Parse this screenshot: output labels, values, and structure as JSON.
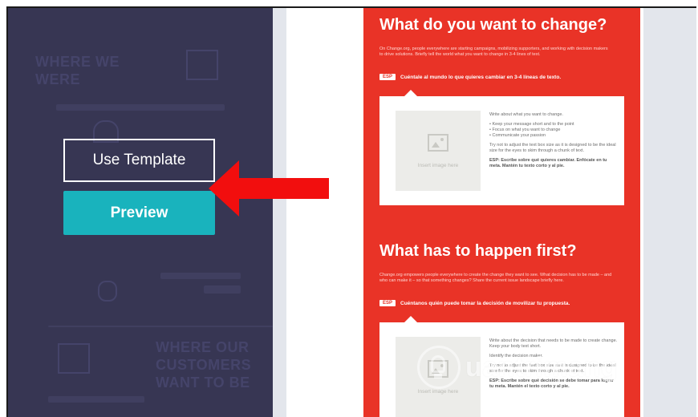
{
  "left_panel": {
    "ghost_heading_1": "WHERE WE WERE",
    "ghost_heading_2": "WHERE OUR CUSTOMERS WANT TO BE",
    "use_template_label": "Use Template",
    "preview_label": "Preview",
    "bg_color": "#373653",
    "preview_color": "#19b3bd"
  },
  "preview": {
    "bg_color": "#e93327",
    "section1": {
      "title": "What do you want to change?",
      "intro": "On Change.org, people everywhere are starting campaigns, mobilizing supporters, and working with decision makers to drive solutions. Briefly tell the world what you want to change in 3-4 lines of text.",
      "esp_tag": "ESP",
      "esp_text": "Cuéntale al mundo lo que quieres cambiar en 3-4 líneas de texto.",
      "image_caption": "Insert image here",
      "card_lead": "Write about what you want to change.",
      "bullets": [
        "Keep your message short and to the point",
        "Focus on what you want to change",
        "Communicate your passion"
      ],
      "card_note": "Try not to adjust the text box size as it is designed to be the ideal size for the eyes to skim through a chunk of text.",
      "card_esp": "ESP: Escribe sobre qué quieres cambiar. Enfócate en tu meta. Mantén tu texto corto y al pie."
    },
    "section2": {
      "title": "What has to happen first?",
      "intro": "Change.org empowers people everywhere to create the change they want to see. What decision has to be made – and who can make it – so that something changes? Share the current issue landscape briefly here.",
      "esp_tag": "ESP",
      "esp_text": "Cuéntanos quién puede tomar la decisión de movilizar tu propuesta.",
      "image_caption": "Insert image here",
      "card_lead": "Write about the decision that needs to be made to create change. Keep your body text short.",
      "card_mid": "Identify the decision maker.",
      "card_note": "Try not to adjust the text box size as it is designed to be the ideal size for the eyes to skim through a chunk of text.",
      "card_esp": "ESP: Escribe sobre qué decisión se debe tomar para lograr tu meta. Mantén el texto corto y al pie."
    }
  },
  "annotation": {
    "arrow_color": "#f20e0e"
  },
  "watermark": {
    "text": "uantrimang"
  }
}
